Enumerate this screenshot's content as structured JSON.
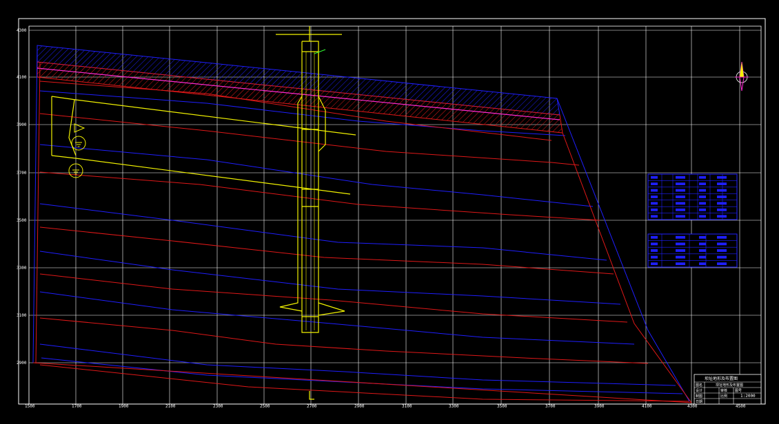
{
  "axes": {
    "x_ticks": [
      "1500",
      "1700",
      "1900",
      "2100",
      "2300",
      "2500",
      "2700",
      "2900",
      "3100",
      "3300",
      "3500",
      "3700",
      "3900",
      "4100",
      "4300",
      "4500"
    ],
    "y_ticks": [
      "4300",
      "4100",
      "3900",
      "3700",
      "3500",
      "3300",
      "3100",
      "2900"
    ]
  },
  "colors": {
    "background": "#000000",
    "grid": "#ffffff",
    "blue_contour": "#1f1fff",
    "red_contour": "#e01818",
    "magenta_line": "#ff2ad4",
    "structure": "#f2f200",
    "accent_green": "#33ff33"
  },
  "contours": {
    "blue_count": 8,
    "red_count": 8
  },
  "icons": {
    "north_arrow": "north-arrow-icon",
    "water_level": "water-level-symbol-icon"
  },
  "tables": {
    "table1_rows": 7,
    "table2_rows": 5
  },
  "title_block": {
    "title": "坝址地形及布置图",
    "row1_label": "图名",
    "row1_value": "坝址地形及布置图",
    "row2_label": "设计",
    "row2_value": "审核",
    "row2_extra": "图号",
    "row3_label": "制图",
    "row3_value": "比例",
    "scale": "1:2000",
    "row4_label": "日期"
  }
}
